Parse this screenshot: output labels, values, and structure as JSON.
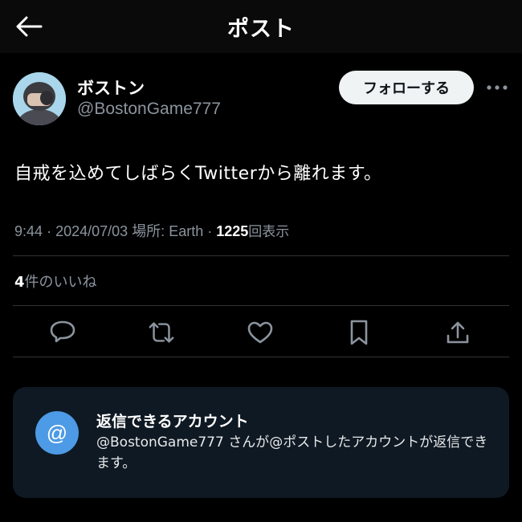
{
  "header": {
    "title": "ポスト",
    "back_icon": "arrow-left-icon"
  },
  "author": {
    "display_name": "ボストン",
    "handle": "@BostonGame777",
    "follow_label": "フォローする",
    "more_icon": "more-horizontal-icon"
  },
  "tweet": {
    "text": "自戒を込めてしばらくTwitterから離れます。",
    "time": "9:44",
    "date": "2024/07/03",
    "location": "場所: Earth",
    "views_count": "1225",
    "views_label": "回表示",
    "separator": "·"
  },
  "likes": {
    "count": "4",
    "label": "件のいいね"
  },
  "actions": [
    {
      "name": "reply",
      "icon": "reply-icon"
    },
    {
      "name": "retweet",
      "icon": "retweet-icon"
    },
    {
      "name": "like",
      "icon": "heart-icon"
    },
    {
      "name": "bookmark",
      "icon": "bookmark-icon"
    },
    {
      "name": "share",
      "icon": "share-icon"
    }
  ],
  "reply_settings": {
    "icon_text": "@",
    "title": "返信できるアカウント",
    "description": "@BostonGame777 さんが@ポストしたアカウントが返信できます。"
  },
  "colors": {
    "background": "#000000",
    "text_primary": "#e7e9ea",
    "text_secondary": "#8b949e",
    "accent": "#4d9ae6",
    "card_background": "#0f1923"
  }
}
